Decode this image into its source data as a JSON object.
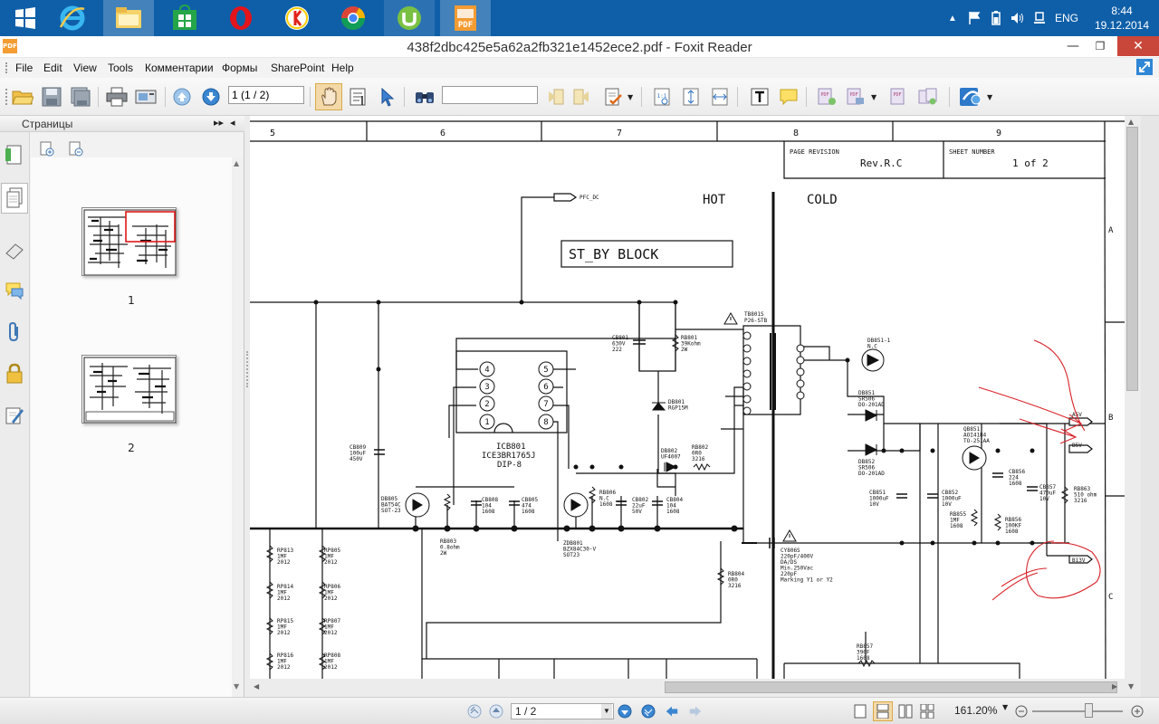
{
  "taskbar": {
    "apps": [
      {
        "name": "start-icon"
      },
      {
        "name": "internet-explorer-icon"
      },
      {
        "name": "file-explorer-icon"
      },
      {
        "name": "store-icon"
      },
      {
        "name": "opera-icon"
      },
      {
        "name": "yandex-browser-icon"
      },
      {
        "name": "chrome-icon"
      },
      {
        "name": "utorrent-icon"
      },
      {
        "name": "foxit-reader-icon"
      }
    ],
    "language": "ENG",
    "time": "8:44",
    "date": "19.12.2014"
  },
  "window": {
    "title": "438f2dbc425e5a62a2fb321e1452ece2.pdf - Foxit Reader",
    "app_badge": "PDF"
  },
  "menu": [
    "File",
    "Edit",
    "View",
    "Tools",
    "Комментарии",
    "Формы",
    "SharePoint",
    "Help"
  ],
  "toolbar": {
    "page_field": "1 (1 / 2)",
    "find_placeholder": ""
  },
  "sidepanel": {
    "title": "Страницы",
    "thumbnails": [
      {
        "label": "1"
      },
      {
        "label": "2"
      }
    ]
  },
  "document": {
    "column_numbers": [
      "5",
      "6",
      "7",
      "8",
      "9"
    ],
    "row_letters": [
      "A",
      "B",
      "C"
    ],
    "page_revision_label": "PAGE REVISION",
    "page_revision_value": "Rev.R.C",
    "sheet_number_label": "SHEET NUMBER",
    "sheet_number_value": "1 of 2",
    "hot_label": "HOT",
    "cold_label": "COLD",
    "block_title": "ST_BY BLOCK",
    "net_pfc": "PFC_DC",
    "ic_name": "ICB801",
    "ic_part": "ICE3BR1765J",
    "ic_package": "DIP-8",
    "ic_pins": [
      "4",
      "3",
      "2",
      "1",
      "5",
      "6",
      "7",
      "8"
    ],
    "transformer_ref": "TB801S",
    "transformer_part": "P26-STB",
    "outputs": [
      "A5V",
      "B5V",
      "B13V"
    ],
    "components": [
      "CB801\n630V\n222",
      "RB801\n39Kohm\n2W",
      "DB801\nRGP15M",
      "DB851-1\nN.C",
      "DB851\nSR506\nDO-201AD",
      "DB852\nSR506\nDO-201AD",
      "QB851\nAOI4184\nTO-251AA",
      "CB856\n224\n1608",
      "CB857\n470uF\n10V",
      "RB863\n510 ohm\n3216",
      "CB851\n1000uF\n10V",
      "CB852\n1000uF\n10V",
      "RB855\n1MF\n1608",
      "RB856\n100KF\n1608",
      "CB809\n100uF\n450V",
      "DB802\nUF4007",
      "RB802\n0R0\n3216",
      "DB805\nBAT54C\nSOT-23",
      "CB808\n104\n1608",
      "CB805\n474\n1608",
      "RB806\nN.C\n1608",
      "CB802\n22uF\n50V",
      "CB804\n104\n1608",
      "RB803\n0.8ohm\n2W",
      "ZDB801\nBZX84C30-V\nSOT23",
      "RB804\n0R0\n3216",
      "CY806S\n220pF/400V\nDA/DS\nMin.250Vac\n220pF\nMarking Y1 or Y2",
      "RB857\n390F\n1608",
      "RP813\n1MF\n2012",
      "RP805\n1MF\n2012",
      "RP814\n1MF\n2012",
      "RP806\n1MF\n2012",
      "RP815\n1MF\n2012",
      "RP807\n1MF\n2012",
      "RP816\n1MF\n2012",
      "RP808\n1MF\n2012"
    ]
  },
  "statusbar": {
    "page_select": "1 / 2",
    "zoom": "161.20%"
  },
  "colors": {
    "taskbar": "#0f5fa8",
    "close_button": "#c9473a",
    "annotation_red": "#d8232a"
  }
}
